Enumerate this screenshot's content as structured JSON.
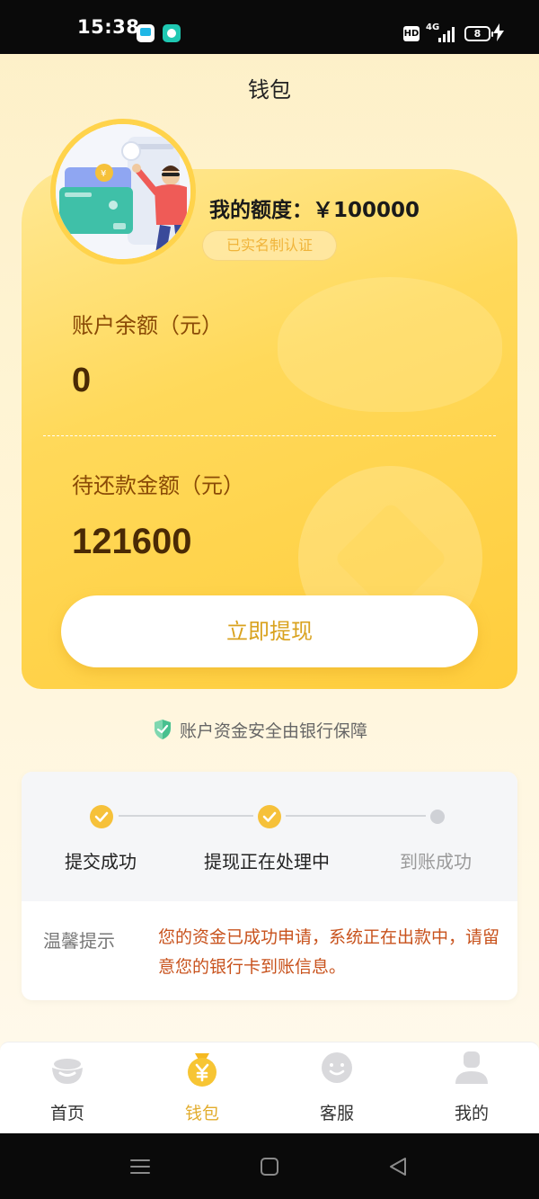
{
  "status_bar": {
    "time": "15:38",
    "network": "4G",
    "hd": "HD",
    "battery": "8"
  },
  "header": {
    "title": "钱包"
  },
  "wallet": {
    "quota_label": "我的额度：￥100000",
    "verified_badge": "已实名制认证",
    "balance_label": "账户余额（元）",
    "balance_value": "0",
    "repay_label": "待还款金额（元）",
    "repay_value": "121600",
    "withdraw_button": "立即提现"
  },
  "security_note": "账户资金安全由银行保障",
  "progress": {
    "steps": [
      {
        "label": "提交成功",
        "status": "done"
      },
      {
        "label": "提现正在处理中",
        "status": "done"
      },
      {
        "label": "到账成功",
        "status": "pending"
      }
    ],
    "tip_title": "温馨提示",
    "tip_text": "您的资金已成功申请，系统正在出款中，请留意您的银行卡到账信息。"
  },
  "bottom_nav": {
    "items": [
      {
        "label": "首页",
        "icon": "home-icon",
        "active": false
      },
      {
        "label": "钱包",
        "icon": "wallet-yen-icon",
        "active": true
      },
      {
        "label": "客服",
        "icon": "customer-service-icon",
        "active": false
      },
      {
        "label": "我的",
        "icon": "profile-icon",
        "active": false
      }
    ]
  },
  "colors": {
    "accent": "#F6C13A",
    "card_gradient_start": "#FFE894",
    "card_gradient_end": "#FFCD3C",
    "button_text": "#D9A21E",
    "tip_text": "#C8521C",
    "label_brown": "#8A4A06"
  }
}
